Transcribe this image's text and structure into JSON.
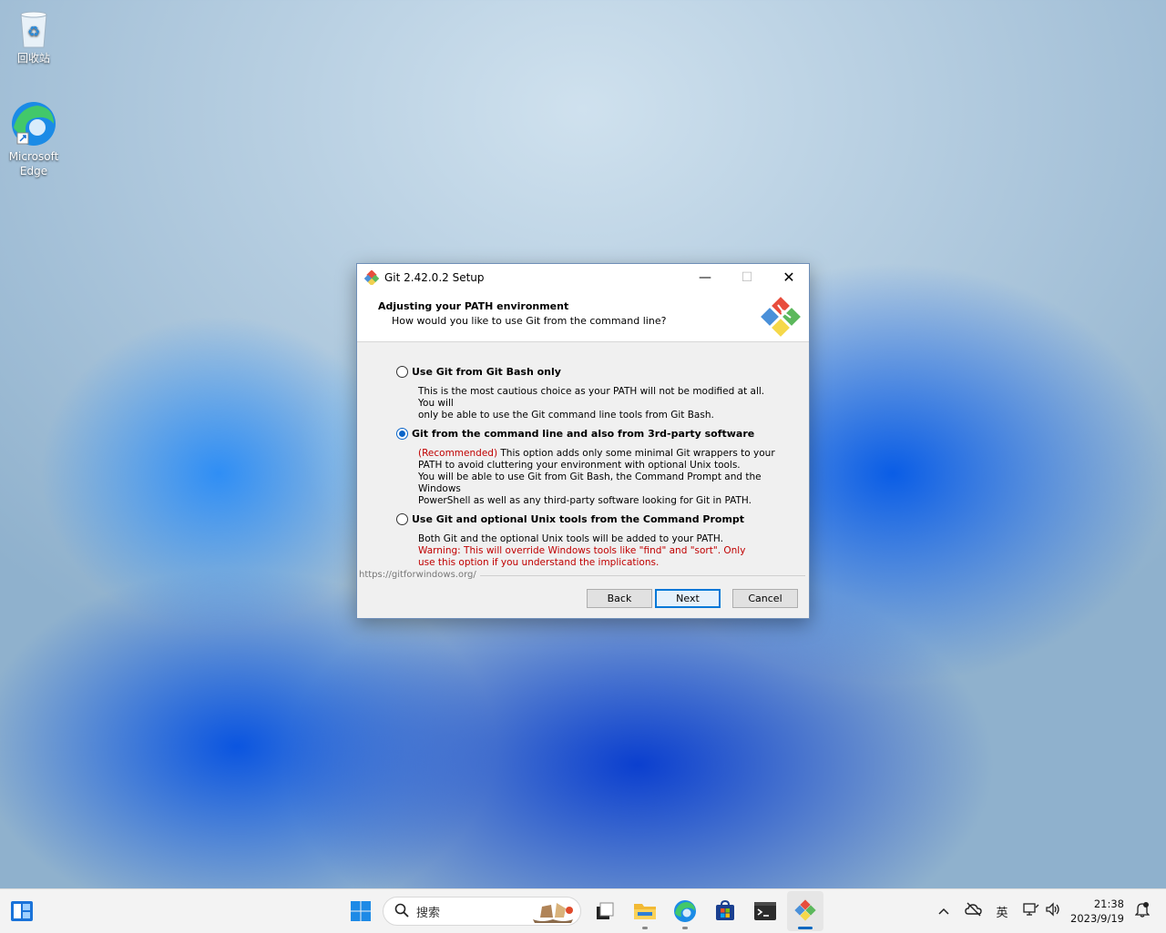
{
  "desktop": {
    "icons": [
      {
        "label": "回收站"
      },
      {
        "label": "Microsoft Edge"
      }
    ]
  },
  "dialog": {
    "title": "Git 2.42.0.2 Setup",
    "header_title": "Adjusting your PATH environment",
    "header_subtitle": "How would you like to use Git from the command line?",
    "options": [
      {
        "label": "Use Git from Git Bash only",
        "selected": false,
        "desc_lines": [
          "This is the most cautious choice as your PATH will not be modified at all. You will",
          "only be able to use the Git command line tools from Git Bash."
        ]
      },
      {
        "label": "Git from the command line and also from 3rd-party software",
        "selected": true,
        "recommended": "(Recommended)",
        "desc_first_rest": " This option adds only some minimal Git wrappers to your",
        "desc_lines": [
          "PATH to avoid cluttering your environment with optional Unix tools.",
          "You will be able to use Git from Git Bash, the Command Prompt and the Windows",
          "PowerShell as well as any third-party software looking for Git in PATH."
        ]
      },
      {
        "label": "Use Git and optional Unix tools from the Command Prompt",
        "selected": false,
        "desc_lines": [
          "Both Git and the optional Unix tools will be added to your PATH."
        ],
        "warning_lines": [
          "Warning: This will override Windows tools like \"find\" and \"sort\". Only",
          "use this option if you understand the implications."
        ]
      }
    ],
    "url": "https://gitforwindows.org/",
    "buttons": {
      "back": "Back",
      "next": "Next",
      "cancel": "Cancel"
    }
  },
  "taskbar": {
    "search_placeholder": "搜索",
    "ime": "英",
    "time": "21:38",
    "date": "2023/9/19"
  },
  "colors": {
    "accent": "#0078d7",
    "warning": "#c00000"
  }
}
